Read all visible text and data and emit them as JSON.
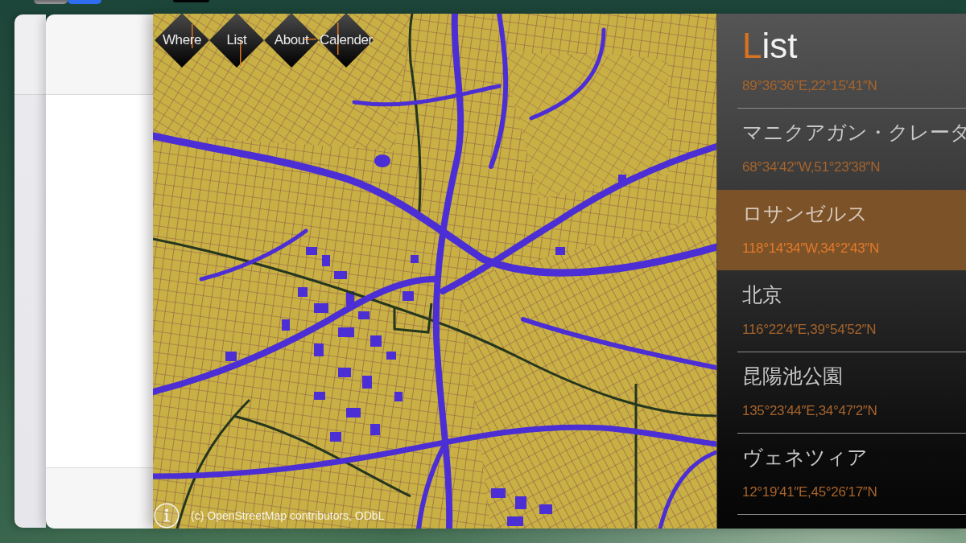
{
  "nav_buttons": [
    {
      "label": "Where"
    },
    {
      "label": "List"
    },
    {
      "label": "About"
    },
    {
      "label": "Calender"
    }
  ],
  "map": {
    "attribution": "(c) OpenStreetMap contributors, ODbL"
  },
  "list_panel": {
    "title": "List",
    "items": [
      {
        "coordinates": "89°36′36″E,22°15′41″N",
        "selected": false
      },
      {
        "name": "マニクアガン・クレータ",
        "coordinates": "68°34′42″W,51°23′38″N",
        "selected": false
      },
      {
        "name": "ロサンゼルス",
        "coordinates": "118°14′34″W,34°2′43″N",
        "selected": true
      },
      {
        "name": "北京",
        "coordinates": "116°22′4″E,39°54′52″N",
        "selected": false
      },
      {
        "name": "昆陽池公園",
        "coordinates": "135°23′44″E,34°47′2″N",
        "selected": false
      },
      {
        "name": "ヴェネツィア",
        "coordinates": "12°19′41″E,45°26′17″N",
        "selected": false
      }
    ]
  }
}
